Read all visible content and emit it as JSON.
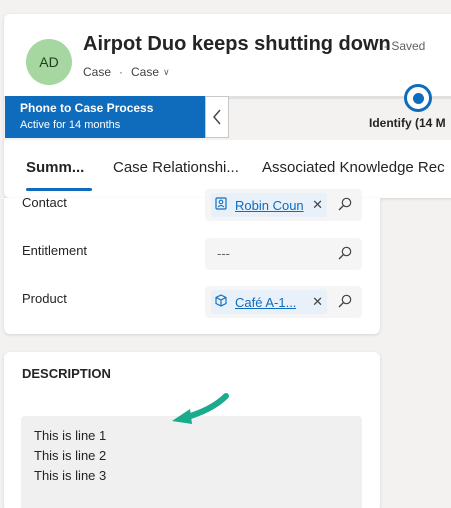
{
  "header": {
    "avatar_initials": "AD",
    "title": "Airpot Duo keeps shutting down",
    "save_status": "- Saved",
    "entity": "Case",
    "form_selector": "Case"
  },
  "bpf": {
    "process_name": "Phone to Case Process",
    "process_age": "Active for 14 months",
    "collapse_icon": "chevron-left-icon",
    "stage_label": "Identify  (14 M"
  },
  "tabs": [
    {
      "label": "Summ..."
    },
    {
      "label": "Case Relationshi..."
    },
    {
      "label": "Associated Knowledge Rec"
    }
  ],
  "fields": {
    "contact": {
      "label": "Contact",
      "value": "Robin Coun",
      "icon": "contact-card-icon"
    },
    "entitlement": {
      "label": "Entitlement",
      "value": "---"
    },
    "product": {
      "label": "Product",
      "value": "Café A-1...",
      "icon": "product-box-icon"
    }
  },
  "description": {
    "title": "DESCRIPTION",
    "lines": [
      "This is line 1",
      "This is line 2",
      "This is line 3"
    ]
  },
  "colors": {
    "brand": "#0f6cbd",
    "avatar_bg": "#a7d7a0",
    "annotation_arrow": "#1aaa8c"
  }
}
